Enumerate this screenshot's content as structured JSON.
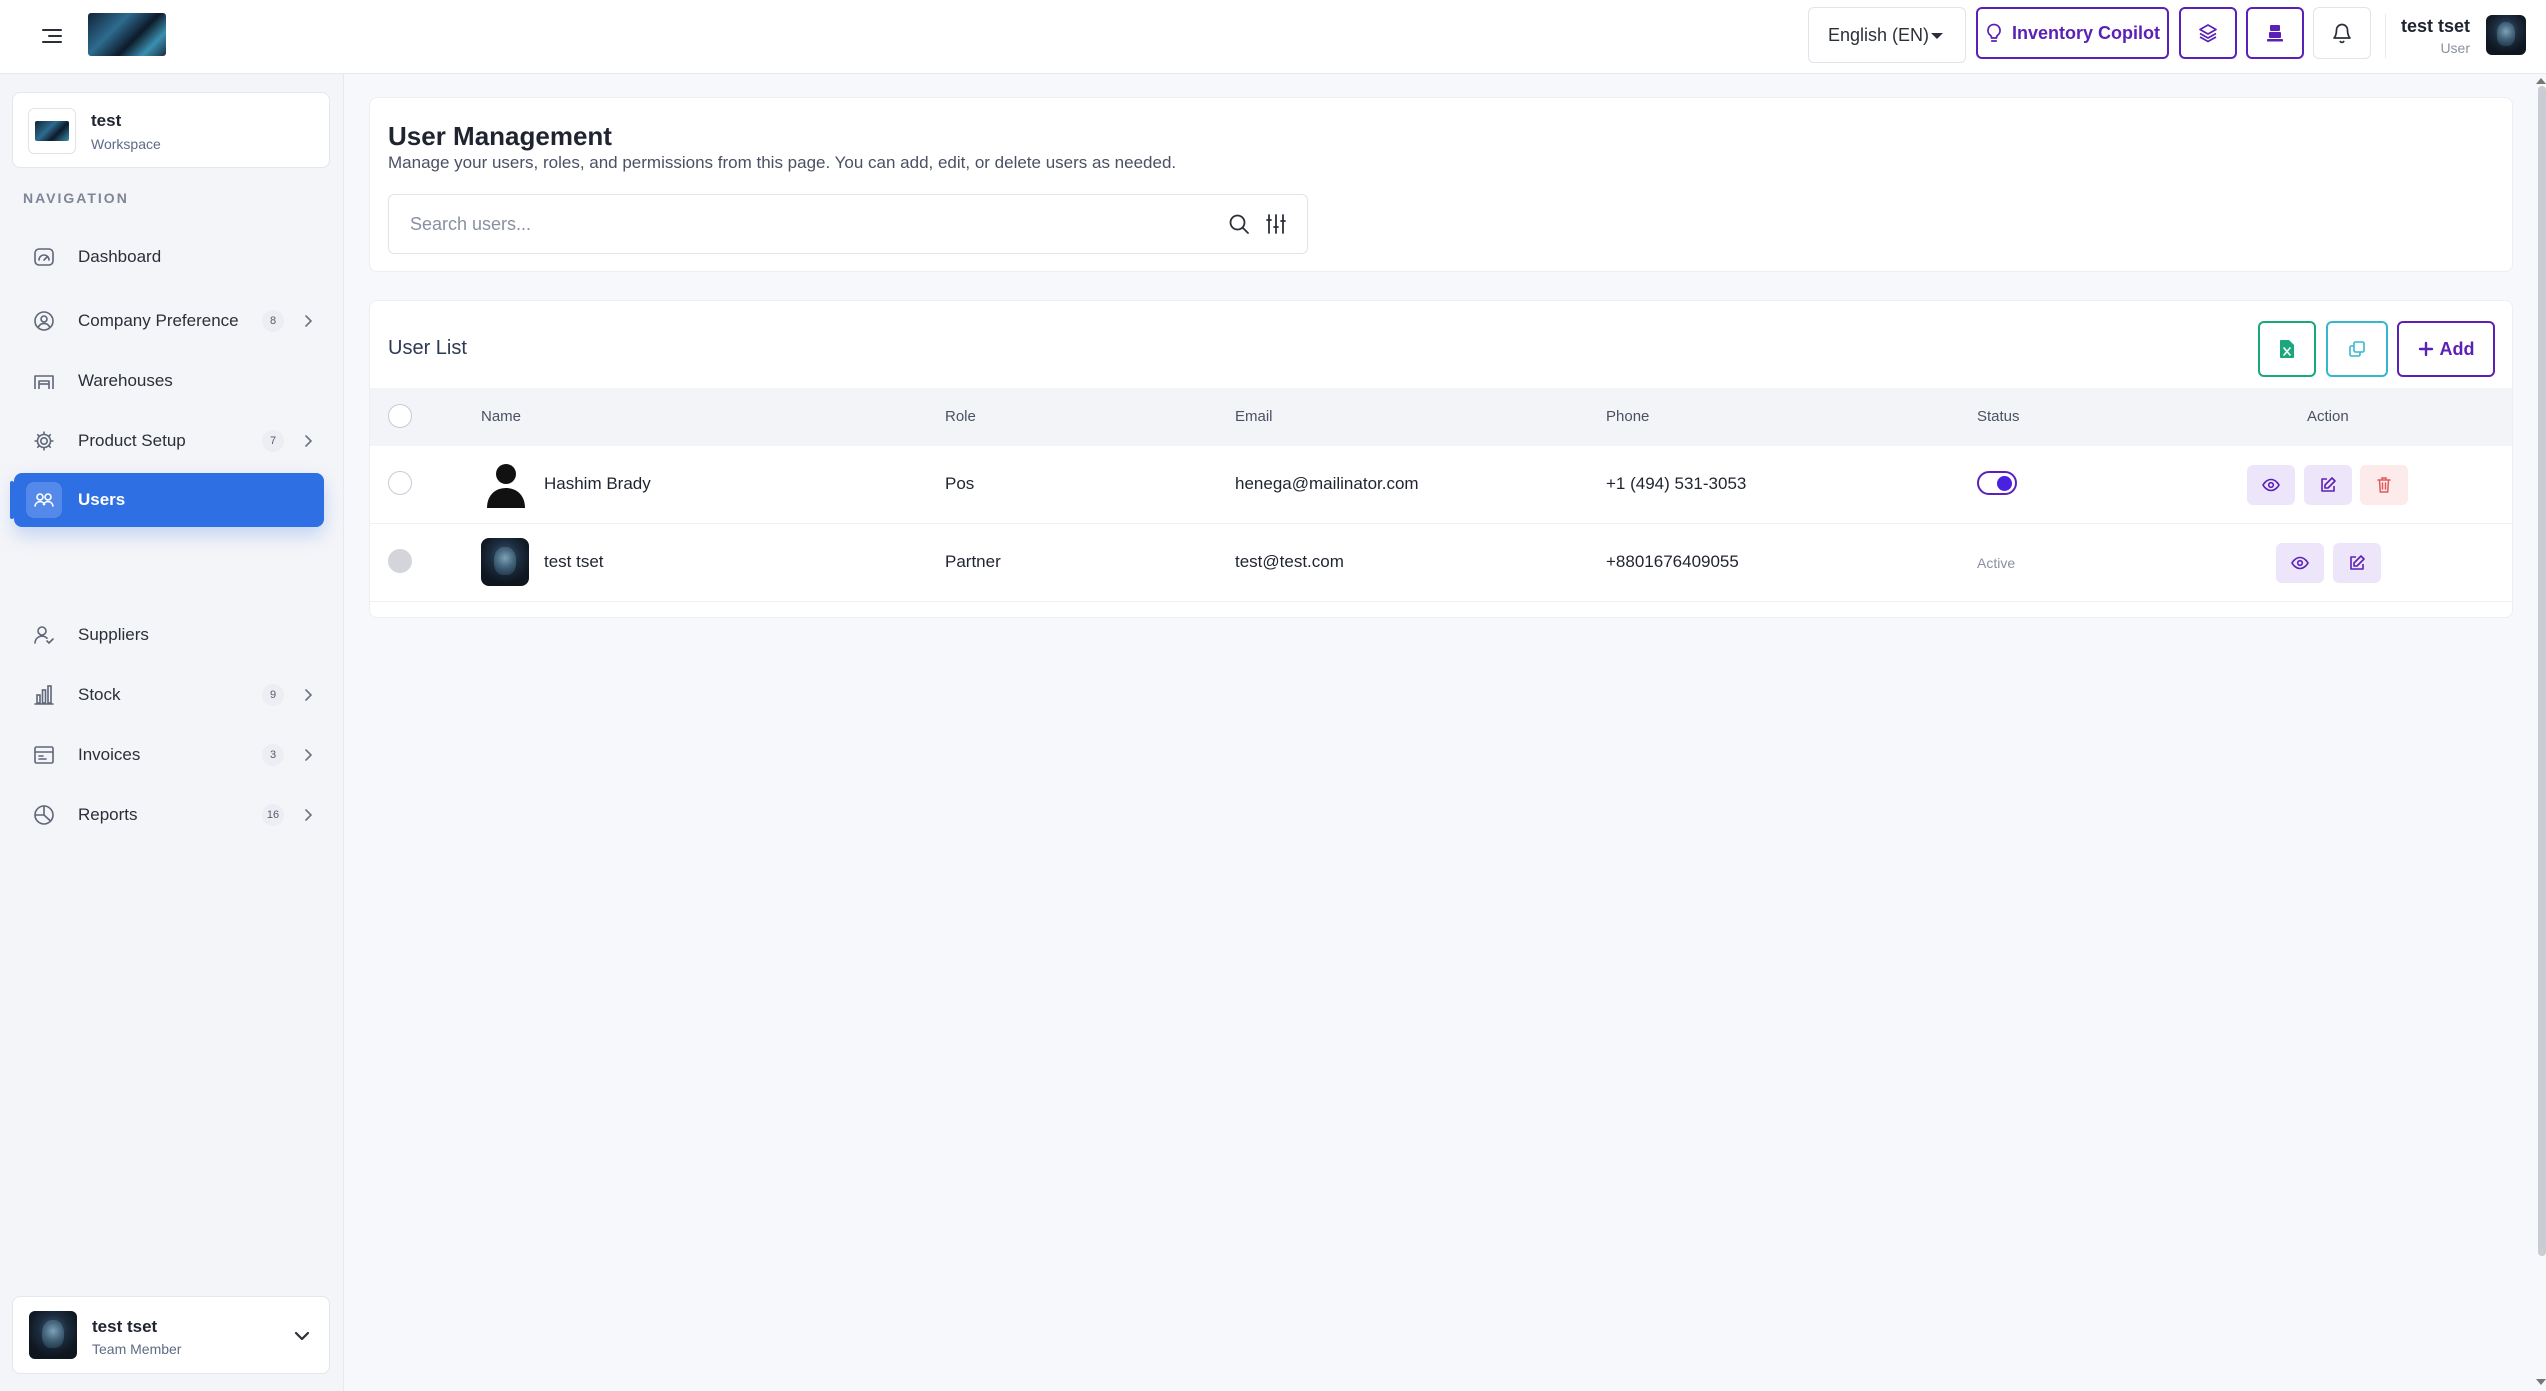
{
  "header": {
    "language": "English (EN)",
    "copilot_label": "Inventory Copilot",
    "user_name": "test tset",
    "user_role": "User"
  },
  "sidebar": {
    "workspace_name": "test",
    "workspace_label": "Workspace",
    "nav_heading": "NAVIGATION",
    "items": [
      {
        "label": "Dashboard",
        "icon": "dashboard-icon"
      },
      {
        "label": "Company Preference",
        "icon": "company-icon",
        "badge": "8"
      },
      {
        "label": "Warehouses",
        "icon": "warehouse-icon"
      },
      {
        "label": "Product Setup",
        "icon": "gear-icon",
        "badge": "7"
      },
      {
        "label": "Users",
        "icon": "users-icon",
        "active": true
      },
      {
        "label": "Suppliers",
        "icon": "supplier-icon"
      },
      {
        "label": "Stock",
        "icon": "stock-icon",
        "badge": "9"
      },
      {
        "label": "Invoices",
        "icon": "invoice-icon",
        "badge": "3"
      },
      {
        "label": "Reports",
        "icon": "reports-icon",
        "badge": "16"
      }
    ],
    "footer_user_name": "test tset",
    "footer_user_role": "Team Member"
  },
  "page": {
    "title": "User Management",
    "subtitle": "Manage your users, roles, and permissions from this page. You can add, edit, or delete users as needed.",
    "search_placeholder": "Search users..."
  },
  "user_list": {
    "title": "User List",
    "add_label": "Add",
    "columns": [
      "Name",
      "Role",
      "Email",
      "Phone",
      "Status",
      "Action"
    ],
    "rows": [
      {
        "name": "Hashim Brady",
        "role": "Pos",
        "email": "henega@mailinator.com",
        "phone": "+1 (494) 531-3053",
        "status_toggle": true
      },
      {
        "name": "test tset",
        "role": "Partner",
        "email": "test@test.com",
        "phone": "+8801676409055",
        "status": "Active"
      }
    ]
  },
  "colors": {
    "primary_purple": "#5b21b6",
    "active_nav_blue": "#2f6fe4",
    "excel_green": "#1aa77c",
    "copy_cyan": "#37b7cf",
    "delete_red": "#e25b5b"
  }
}
